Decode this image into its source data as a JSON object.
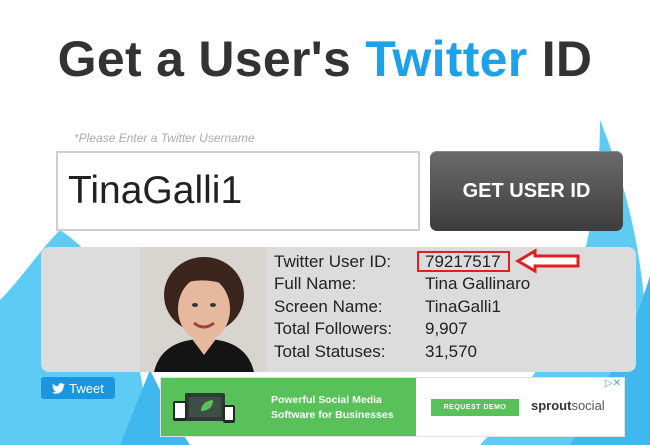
{
  "title": {
    "prefix": "Get a User's ",
    "accent": "Twitter",
    "suffix": " ID"
  },
  "search": {
    "hint": "*Please Enter a Twitter Username",
    "value": "TinaGalli1",
    "button_label": "GET USER ID"
  },
  "result": {
    "labels": [
      "Twitter User ID:",
      "Full Name:",
      "Screen Name:",
      "Total Followers:",
      "Total Statuses:"
    ],
    "values": [
      "79217517",
      "Tina Gallinaro",
      "TinaGalli1",
      "9,907",
      "31,570"
    ]
  },
  "tweet_button": {
    "label": "Tweet",
    "icon": "twitter-bird-icon"
  },
  "ad": {
    "headline_line1": "Powerful Social Media",
    "headline_line2": "Software for Businesses",
    "cta": "REQUEST DEMO",
    "brand_bold": "sprout",
    "brand_light": "social",
    "choices_icons": "ad-choices-icon"
  },
  "colors": {
    "accent": "#1da1e8",
    "highlight": "#e02020",
    "button": "#4a4a4a",
    "ad_green": "#59c15a"
  }
}
